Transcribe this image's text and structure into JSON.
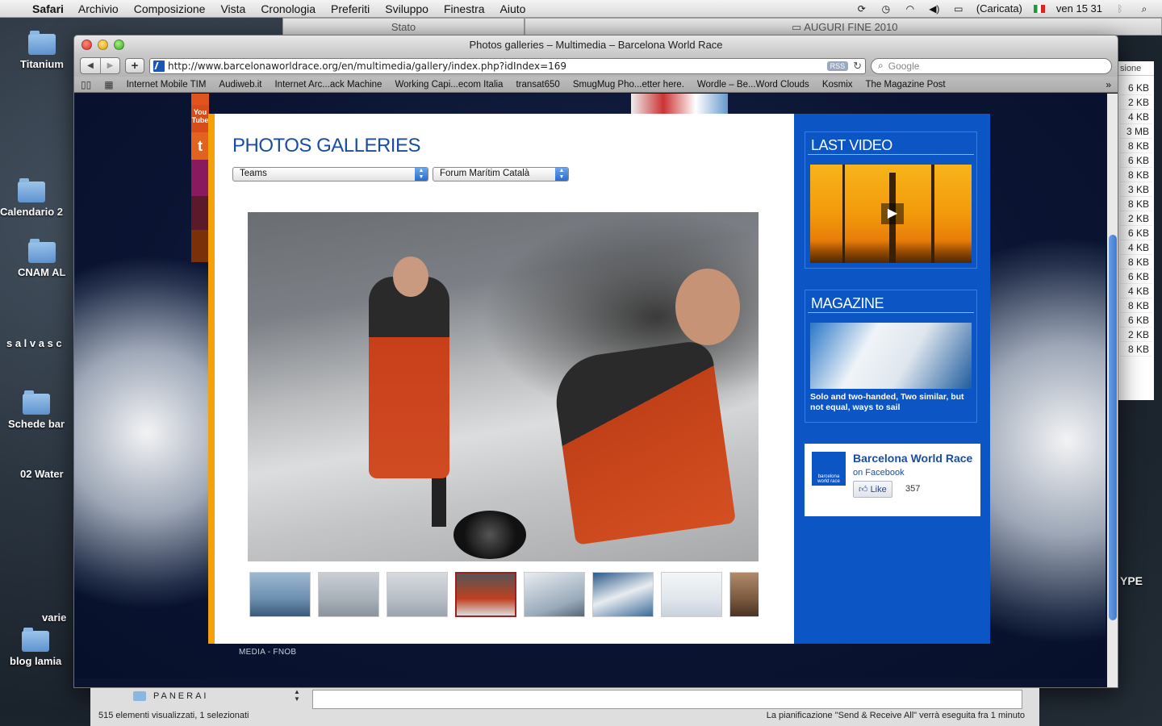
{
  "menubar": {
    "app": "Safari",
    "items": [
      "Archivio",
      "Composizione",
      "Vista",
      "Cronologia",
      "Preferiti",
      "Sviluppo",
      "Finestra",
      "Aiuto"
    ],
    "battery": "(Caricata)",
    "clock": "ven 15 31"
  },
  "background_windows": {
    "stato_title": "Stato",
    "auguri_title": "AUGURI FINE 2010",
    "desktop_icons": [
      "Titanium",
      "Calendario 2",
      "CNAM AL",
      "s a l v a s c",
      "Schede bar",
      "02 Water",
      "varie",
      "blog lamia"
    ],
    "right_column_header": "sione",
    "right_sizes": [
      "6 KB",
      "2 KB",
      "4 KB",
      "3 MB",
      "8 KB",
      "6 KB",
      "8 KB",
      "3 KB",
      "8 KB",
      "2 KB",
      "6 KB",
      "4 KB",
      "8 KB",
      "6 KB",
      "4 KB",
      "8 KB",
      "6 KB",
      "2 KB",
      "8 KB"
    ],
    "right_label": "YPE"
  },
  "safari": {
    "window_title": "Photos galleries – Multimedia – Barcelona World Race",
    "url": "http://www.barcelonaworldrace.org/en/multimedia/gallery/index.php?idIndex=169",
    "rss": "RSS",
    "search_placeholder": "Google",
    "bookmarks": [
      "Internet Mobile TIM",
      "Audiweb.it",
      "Internet Arc...ack Machine",
      "Working Capi...ecom Italia",
      "transat650",
      "SmugMug Pho...etter here.",
      "Wordle – Be...Word Clouds",
      "Kosmix",
      "The Magazine Post"
    ]
  },
  "page": {
    "title": "PHOTOS GALLERIES",
    "select_team": "Teams",
    "select_boat": "Forum Marítim Català",
    "footer": "MEDIA - FNOB",
    "social_youtube": "You Tube",
    "thumbs_count": 8,
    "selected_thumb": 4
  },
  "sidebar": {
    "last_video_title": "LAST VIDEO",
    "magazine_title": "MAGAZINE",
    "magazine_caption": "Solo and two-handed, Two similar, but not equal, ways to sail",
    "fb_name": "Barcelona World Race",
    "fb_on": "on Facebook",
    "fb_like": "Like",
    "fb_count": "357",
    "fb_logo_text": "barcelona world race"
  },
  "mail": {
    "folder": "PANERAI",
    "status_left": "515 elementi visualizzati, 1 selezionati",
    "status_right": "La pianificazione \"Send & Receive All\" verrà eseguita fra 1 minuto"
  }
}
